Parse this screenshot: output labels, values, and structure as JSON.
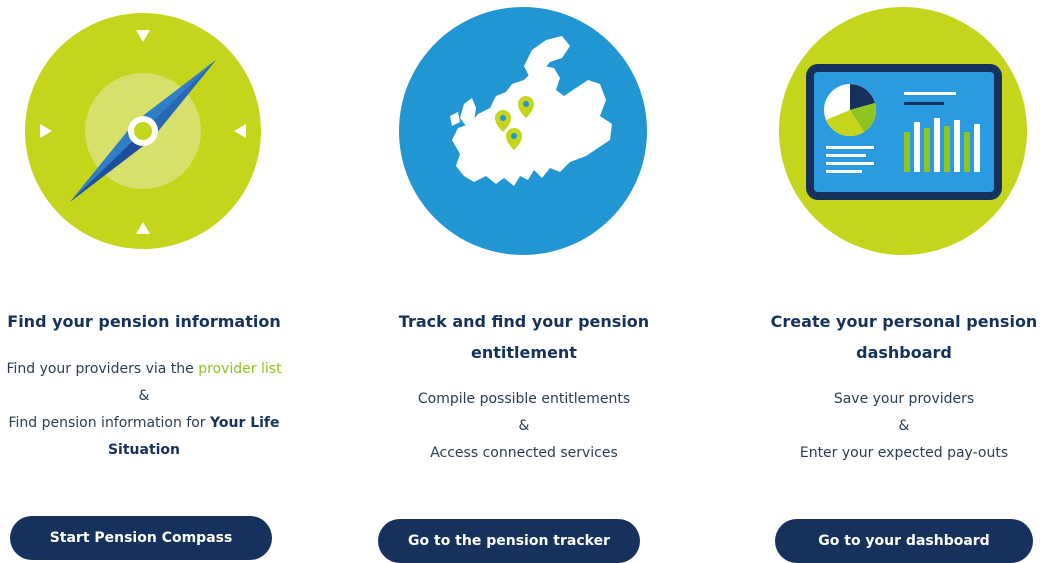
{
  "colors": {
    "navy": "#16325c",
    "lime": "#c5d51b",
    "blue": "#2196d3",
    "green_link": "#8fc31f"
  },
  "cards": [
    {
      "icon": "compass-icon",
      "title": "Find your pension information",
      "line1_pre": "Find your providers via the ",
      "line1_link": "provider list",
      "line2": "&",
      "line3_pre": "Find pension information for ",
      "line3_bold_a": "Your Life",
      "line3_bold_b": "Situation",
      "button": "Start Pension Compass"
    },
    {
      "icon": "europe-map-icon",
      "title_a": "Track and find your pension",
      "title_b": "entitlement",
      "line1": "Compile possible entitlements",
      "line2": "&",
      "line3": "Access connected services",
      "button": "Go to the pension tracker"
    },
    {
      "icon": "dashboard-icon",
      "title_a": "Create your personal pension",
      "title_b": "dashboard",
      "line1": "Save your providers",
      "line2": "&",
      "line3": "Enter your expected pay-outs",
      "button": "Go to your dashboard"
    }
  ]
}
